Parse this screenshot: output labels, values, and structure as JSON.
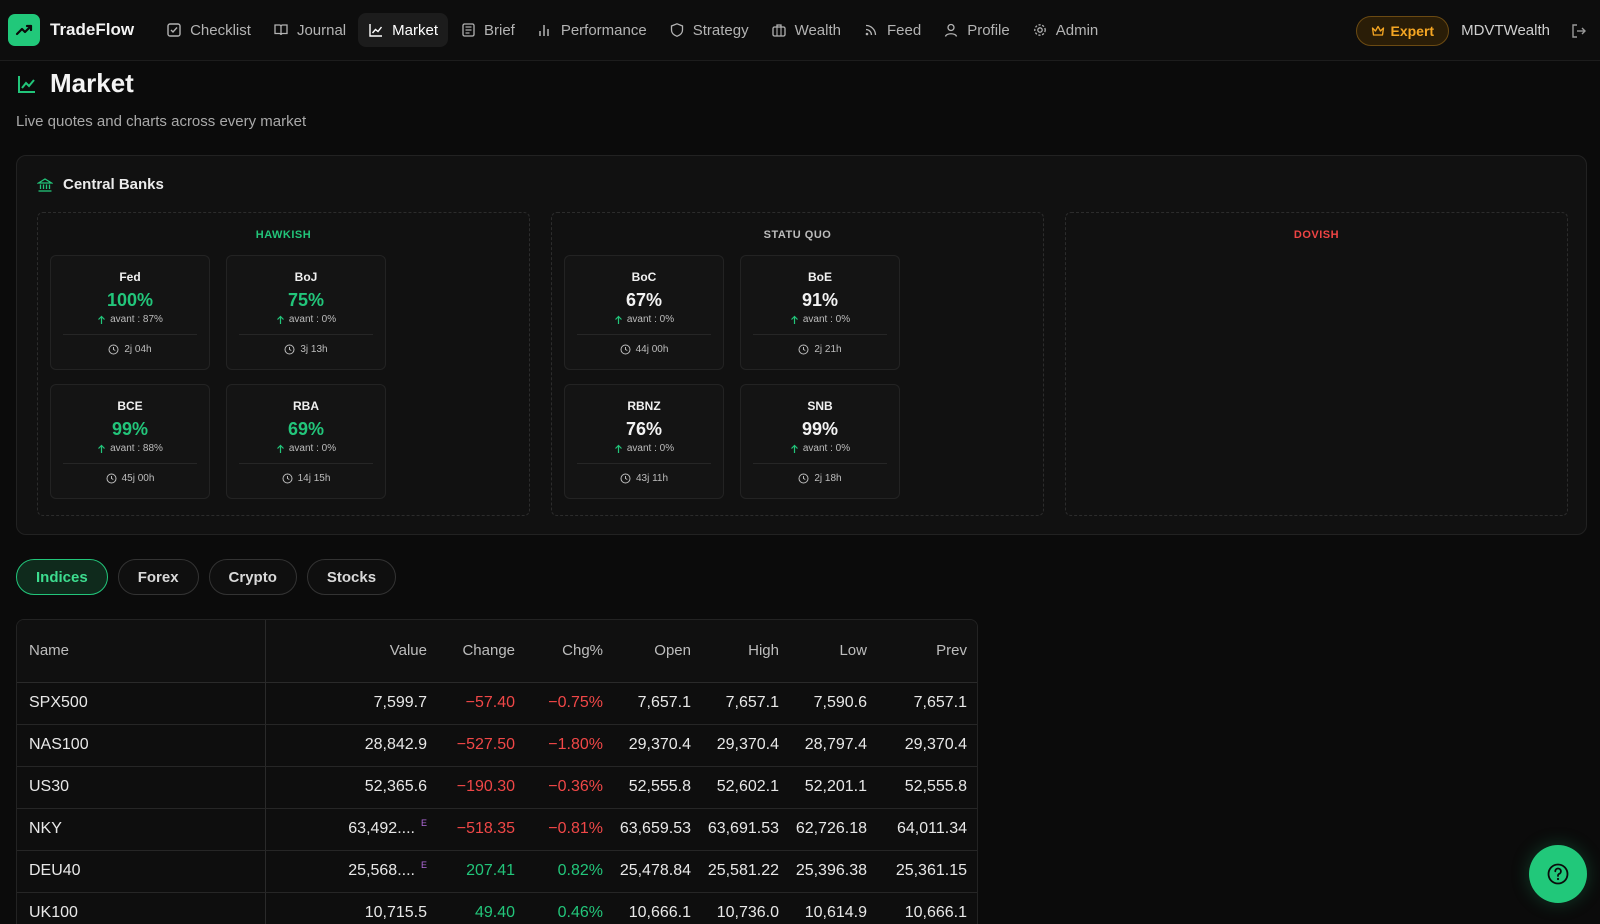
{
  "brand": {
    "name": "TradeFlow"
  },
  "nav": {
    "items": [
      {
        "label": "Checklist",
        "icon": "checklist-icon",
        "active": false
      },
      {
        "label": "Journal",
        "icon": "book-icon",
        "active": false
      },
      {
        "label": "Market",
        "icon": "chart-line-icon",
        "active": true
      },
      {
        "label": "Brief",
        "icon": "newspaper-icon",
        "active": false
      },
      {
        "label": "Performance",
        "icon": "bar-chart-icon",
        "active": false
      },
      {
        "label": "Strategy",
        "icon": "shield-icon",
        "active": false
      },
      {
        "label": "Wealth",
        "icon": "briefcase-icon",
        "active": false
      },
      {
        "label": "Feed",
        "icon": "rss-icon",
        "active": false
      },
      {
        "label": "Profile",
        "icon": "user-icon",
        "active": false
      },
      {
        "label": "Admin",
        "icon": "gear-icon",
        "active": false
      }
    ],
    "badge": "Expert",
    "username": "MDVTWealth"
  },
  "header": {
    "title": "Market",
    "subtitle": "Live quotes and charts across every market"
  },
  "central_banks": {
    "title": "Central Banks",
    "columns": {
      "hawkish": {
        "title": "HAWKISH",
        "cards": [
          {
            "name": "Fed",
            "pct": "100%",
            "prev": "avant : 87%",
            "time": "2j 04h"
          },
          {
            "name": "BoJ",
            "pct": "75%",
            "prev": "avant : 0%",
            "time": "3j 13h"
          },
          {
            "name": "BCE",
            "pct": "99%",
            "prev": "avant : 88%",
            "time": "45j 00h"
          },
          {
            "name": "RBA",
            "pct": "69%",
            "prev": "avant : 0%",
            "time": "14j 15h"
          }
        ]
      },
      "statu_quo": {
        "title": "STATU QUO",
        "cards": [
          {
            "name": "BoC",
            "pct": "67%",
            "prev": "avant : 0%",
            "time": "44j 00h"
          },
          {
            "name": "BoE",
            "pct": "91%",
            "prev": "avant : 0%",
            "time": "2j 21h"
          },
          {
            "name": "RBNZ",
            "pct": "76%",
            "prev": "avant : 0%",
            "time": "43j 11h"
          },
          {
            "name": "SNB",
            "pct": "99%",
            "prev": "avant : 0%",
            "time": "2j 18h"
          }
        ]
      },
      "dovish": {
        "title": "DOVISH",
        "cards": []
      }
    }
  },
  "tabs": [
    "Indices",
    "Forex",
    "Crypto",
    "Stocks"
  ],
  "active_tab": "Indices",
  "table": {
    "headers": [
      "Name",
      "Value",
      "Change",
      "Chg%",
      "Open",
      "High",
      "Low",
      "Prev"
    ],
    "rows": [
      {
        "name": "SPX500",
        "value": "7,599.7",
        "est": "",
        "change": "−57.40",
        "chg_pct": "−0.75%",
        "dir": "neg",
        "open": "7,657.1",
        "high": "7,657.1",
        "low": "7,590.6",
        "prev": "7,657.1"
      },
      {
        "name": "NAS100",
        "value": "28,842.9",
        "est": "",
        "change": "−527.50",
        "chg_pct": "−1.80%",
        "dir": "neg",
        "open": "29,370.4",
        "high": "29,370.4",
        "low": "28,797.4",
        "prev": "29,370.4"
      },
      {
        "name": "US30",
        "value": "52,365.6",
        "est": "",
        "change": "−190.30",
        "chg_pct": "−0.36%",
        "dir": "neg",
        "open": "52,555.8",
        "high": "52,602.1",
        "low": "52,201.1",
        "prev": "52,555.8"
      },
      {
        "name": "NKY",
        "value": "63,492....",
        "est": "E",
        "change": "−518.35",
        "chg_pct": "−0.81%",
        "dir": "neg",
        "open": "63,659.53",
        "high": "63,691.53",
        "low": "62,726.18",
        "prev": "64,011.34"
      },
      {
        "name": "DEU40",
        "value": "25,568....",
        "est": "E",
        "change": "207.41",
        "chg_pct": "0.82%",
        "dir": "pos",
        "open": "25,478.84",
        "high": "25,581.22",
        "low": "25,396.38",
        "prev": "25,361.15"
      },
      {
        "name": "UK100",
        "value": "10,715.5",
        "est": "",
        "change": "49.40",
        "chg_pct": "0.46%",
        "dir": "pos",
        "open": "10,666.1",
        "high": "10,736.0",
        "low": "10,614.9",
        "prev": "10,666.1"
      }
    ]
  },
  "colors": {
    "accent": "#21c87a",
    "negative": "#f04747",
    "badge": "#f5a623",
    "estimate": "#b26bdc"
  }
}
